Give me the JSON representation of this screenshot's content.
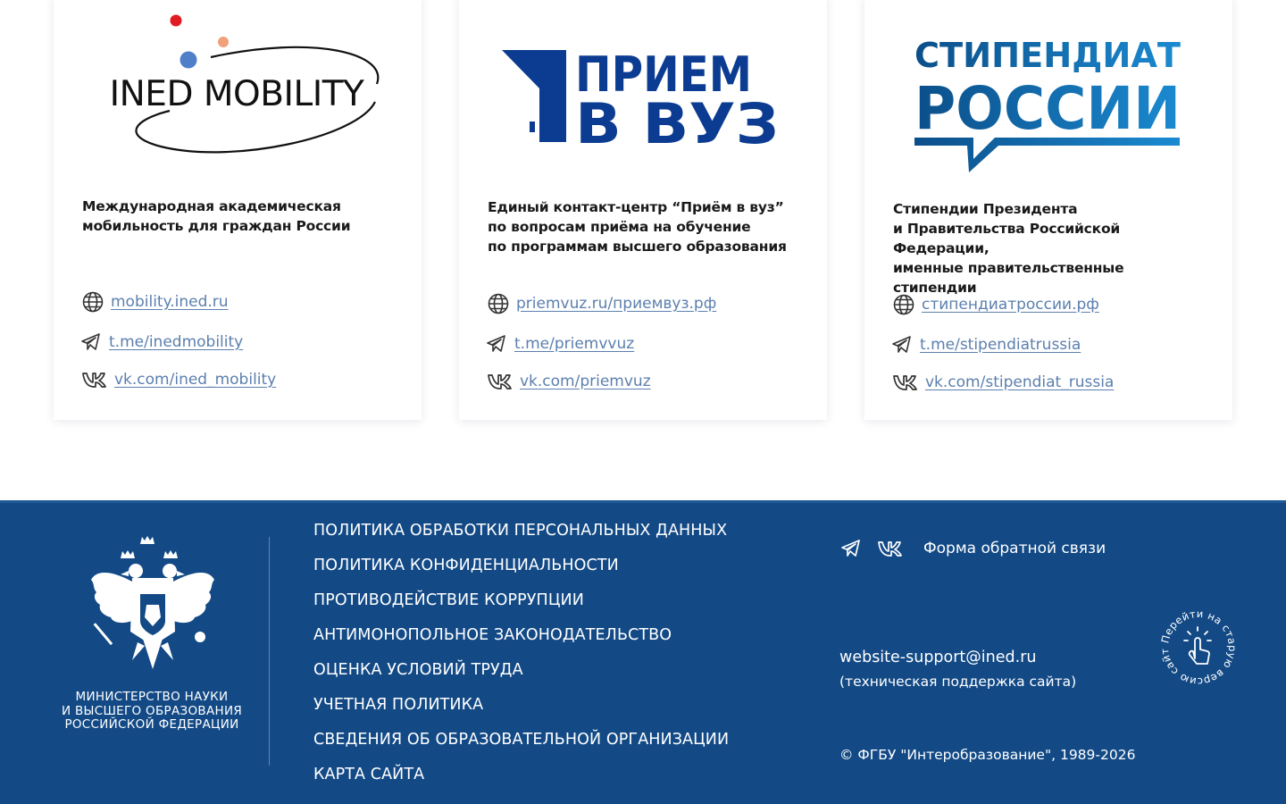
{
  "cards": [
    {
      "logo_text": "INED MOBILITY",
      "description": [
        "Международная академическая",
        "мобильность для граждан России"
      ],
      "links": [
        {
          "icon": "globe-icon",
          "text": "mobility.ined.ru"
        },
        {
          "icon": "telegram-icon",
          "text": "t.me/inedmobility"
        },
        {
          "icon": "vk-icon",
          "text": "vk.com/ined_mobility"
        }
      ]
    },
    {
      "logo_text": [
        "ПРИЕМ",
        "В ВУЗ"
      ],
      "description": [
        "Единый контакт-центр “Приём в вуз”",
        "по вопросам приёма на обучение",
        "по программам высшего образования"
      ],
      "links": [
        {
          "icon": "globe-icon",
          "text": "priemvuz.ru/приемвуз.рф"
        },
        {
          "icon": "telegram-icon",
          "text": "t.me/priemvvuz"
        },
        {
          "icon": "vk-icon",
          "text": "vk.com/priemvuz"
        }
      ]
    },
    {
      "logo_text": [
        "СТИПЕНДИАТ",
        "РОССИИ"
      ],
      "description": [
        "Стипендии Президента",
        "и Правительства Российской Федерации,",
        "именные правительственные стипендии"
      ],
      "links": [
        {
          "icon": "globe-icon",
          "text": "стипендиатроссии.рф"
        },
        {
          "icon": "telegram-icon",
          "text": "t.me/stipendiatrussia"
        },
        {
          "icon": "vk-icon",
          "text": "vk.com/stipendiat_russia"
        }
      ]
    }
  ],
  "footer": {
    "ministry": [
      "МИНИСТЕРСТВО НАУКИ",
      "И ВЫСШЕГО ОБРАЗОВАНИЯ",
      "РОССИЙСКОЙ ФЕДЕРАЦИИ"
    ],
    "nav": [
      "ПОЛИТИКА ОБРАБОТКИ ПЕРСОНАЛЬНЫХ ДАННЫХ",
      "ПОЛИТИКА КОНФИДЕНЦИАЛЬНОСТИ",
      "ПРОТИВОДЕЙСТВИЕ КОРРУПЦИИ",
      "АНТИМОНОПОЛЬНОЕ ЗАКОНОДАТЕЛЬСТВО",
      "ОЦЕНКА УСЛОВИЙ ТРУДА",
      "УЧЕТНАЯ ПОЛИТИКА",
      "СВЕДЕНИЯ ОБ ОБРАЗОВАТЕЛЬНОЙ ОРГАНИЗАЦИИ",
      "КАРТА САЙТА"
    ],
    "feedback": "Форма обратной связи",
    "email": "website-support@ined.ru",
    "support": "(техническая поддержка сайта)",
    "copyright": "© ФГБУ \"Интеробразование\", 1989-2026",
    "old_version": "Перейти на старую версию сайта"
  },
  "colors": {
    "footer_bg": "#134a86",
    "link": "#5b7fae",
    "priem_blue": "#0c3c91",
    "stipendiat_dark": "#0b4f8a",
    "stipendiat_light": "#1b8ad0"
  }
}
